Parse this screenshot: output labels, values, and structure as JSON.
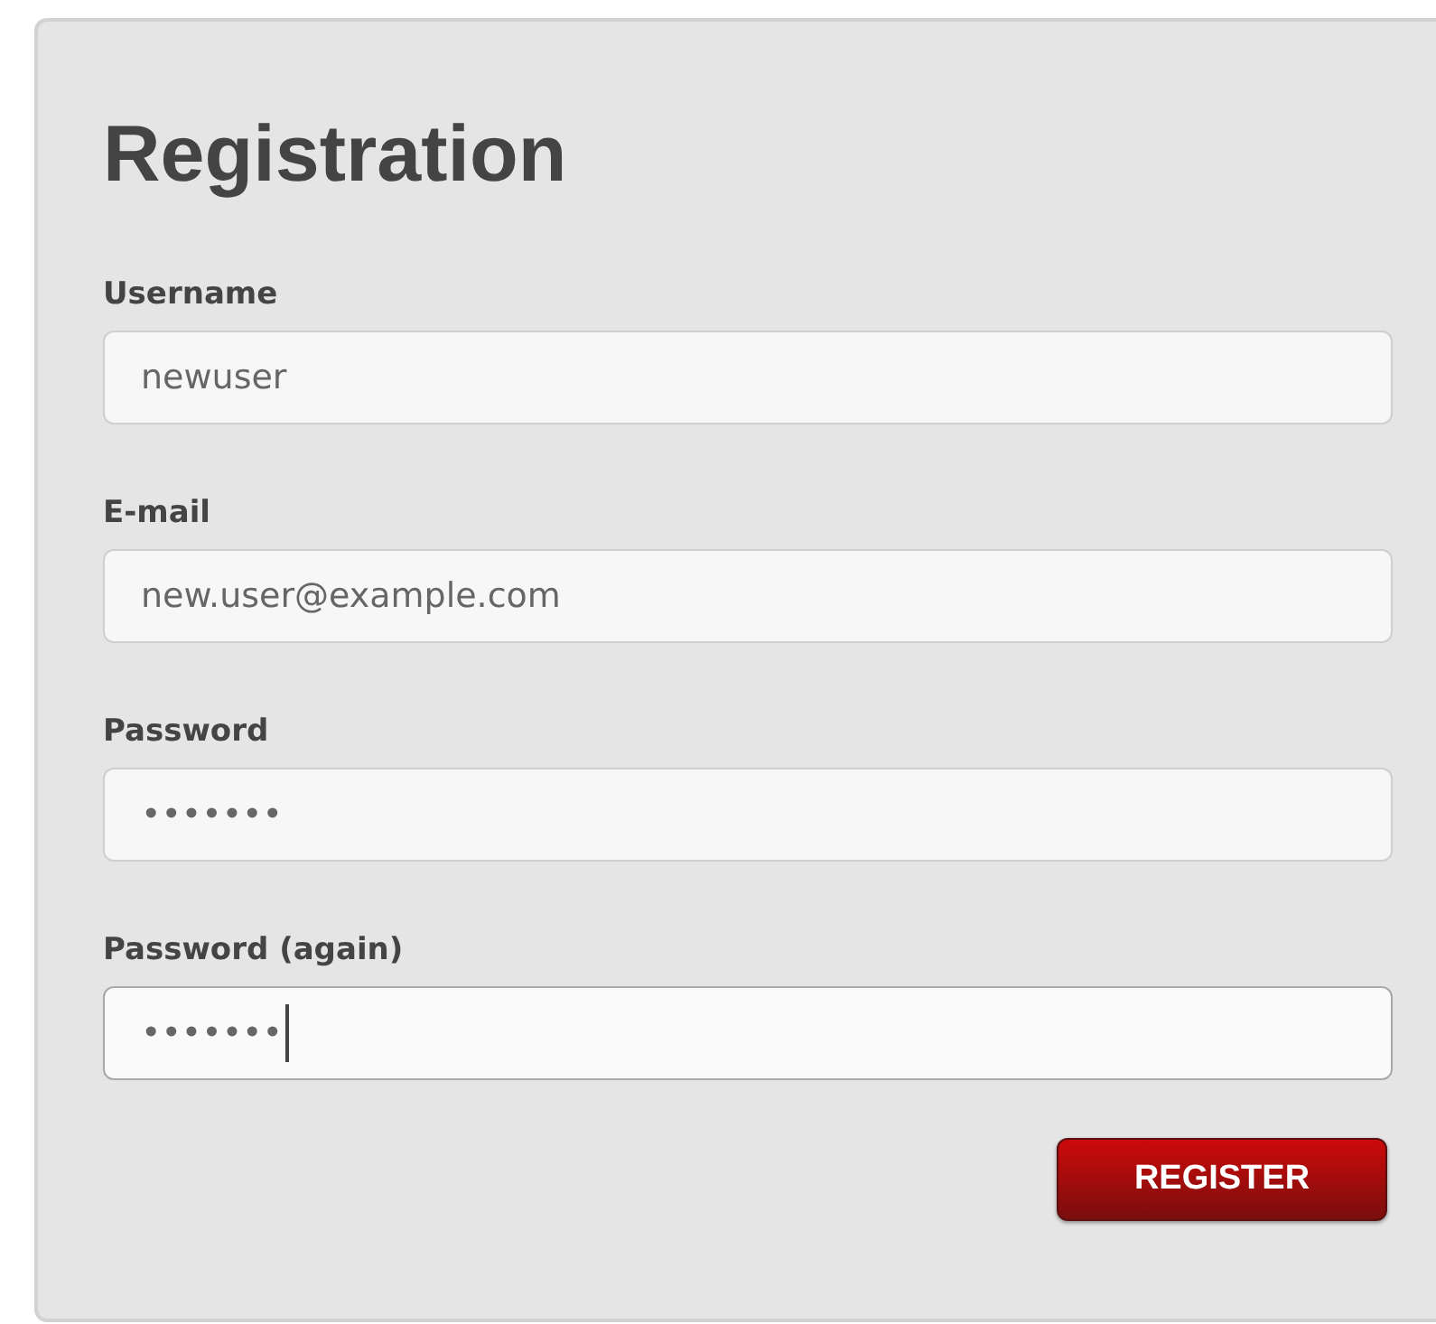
{
  "title": "Registration",
  "fields": [
    {
      "label": "Username",
      "value": "newuser",
      "focused": false
    },
    {
      "label": "E-mail",
      "value": "new.user@example.com",
      "focused": false
    },
    {
      "label": "Password",
      "value": "•••••••",
      "focused": false
    },
    {
      "label": "Password (again)",
      "value": "•••••••",
      "focused": true
    }
  ],
  "buttons": [
    "REGISTER"
  ]
}
